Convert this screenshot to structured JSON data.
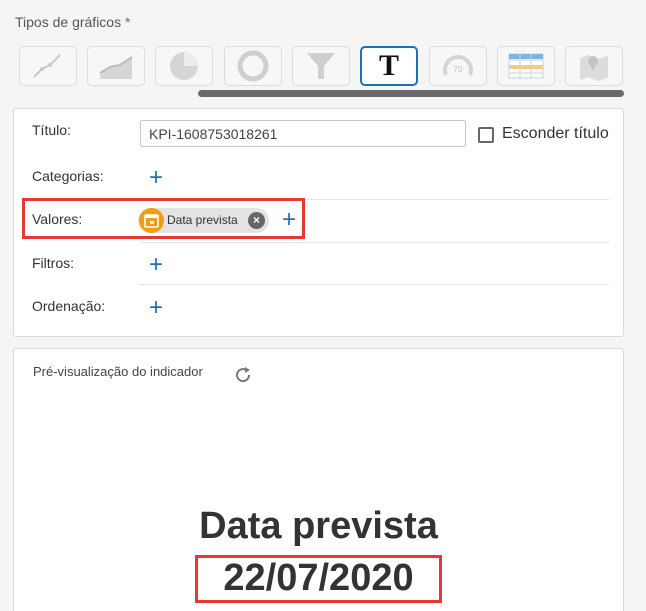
{
  "chart_types": {
    "label": "Tipos de gráficos",
    "required_mark": "*",
    "items": [
      {
        "name": "line-chart-icon",
        "active": false
      },
      {
        "name": "area-chart-icon",
        "active": false
      },
      {
        "name": "pie-chart-icon",
        "active": false
      },
      {
        "name": "donut-chart-icon",
        "active": false
      },
      {
        "name": "funnel-chart-icon",
        "active": false
      },
      {
        "name": "text-kpi-icon",
        "active": true
      },
      {
        "name": "gauge-chart-icon",
        "active": false,
        "text": "70"
      },
      {
        "name": "table-icon",
        "active": false
      },
      {
        "name": "map-icon",
        "active": false
      }
    ],
    "text_glyph": "T"
  },
  "form": {
    "title_label": "Título:",
    "title_value": "KPI-1608753018261",
    "hide_title_label": "Esconder título",
    "categories_label": "Categorias:",
    "values_label": "Valores:",
    "values_chip": "Data prevista",
    "filters_label": "Filtros:",
    "order_label": "Ordenação:",
    "add_symbol": "+"
  },
  "preview": {
    "label": "Pré-visualização do indicador",
    "kpi_title": "Data prevista",
    "kpi_value": "22/07/2020"
  },
  "colors": {
    "accent": "#1c72b8",
    "highlight": "#e53935",
    "chip_icon": "#f39c12"
  }
}
